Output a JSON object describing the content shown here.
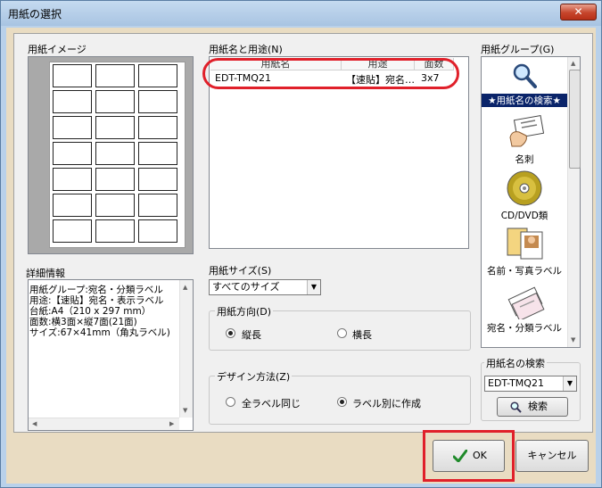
{
  "window": {
    "title": "用紙の選択",
    "close_symbol": "✕"
  },
  "left": {
    "image_label": "用紙イメージ",
    "details_label": "詳細情報",
    "details": [
      "用紙グループ:宛名・分類ラベル",
      "用途:【速貼】宛名・表示ラベル",
      "台紙:A4（210 x 297 mm）",
      "面数:横3面×縦7面(21面)",
      "サイズ:67×41mm（角丸ラベル)"
    ]
  },
  "paper_list": {
    "label": "用紙名と用途(N)",
    "columns": [
      "用紙名",
      "用途",
      "面数"
    ],
    "rows": [
      {
        "name": "EDT-TMQ21",
        "usage": "【速貼】宛名…",
        "faces": "3x7"
      }
    ]
  },
  "size": {
    "label": "用紙サイズ(S)",
    "selected": "すべてのサイズ"
  },
  "orientation": {
    "label": "用紙方向(D)",
    "options": [
      "縦長",
      "横長"
    ],
    "selected_index": 0
  },
  "design": {
    "label": "デザイン方法(Z)",
    "options": [
      "全ラベル同じ",
      "ラベル別に作成"
    ],
    "selected_index": 1
  },
  "groups": {
    "label": "用紙グループ(G)",
    "items": [
      {
        "label": "★用紙名の検索★",
        "icon": "magnifier-icon"
      },
      {
        "label": "名刺",
        "icon": "business-card-icon"
      },
      {
        "label": "CD/DVD類",
        "icon": "cd-icon"
      },
      {
        "label": "名前・写真ラベル",
        "icon": "photo-label-icon"
      },
      {
        "label": "宛名・分類ラベル",
        "icon": "address-label-icon"
      }
    ]
  },
  "search": {
    "label": "用紙名の検索",
    "value": "EDT-TMQ21",
    "button": "検索"
  },
  "buttons": {
    "ok": "OK",
    "cancel": "キャンセル"
  },
  "colors": {
    "highlight_red": "#e0202a",
    "selection_blue": "#0a246a"
  }
}
